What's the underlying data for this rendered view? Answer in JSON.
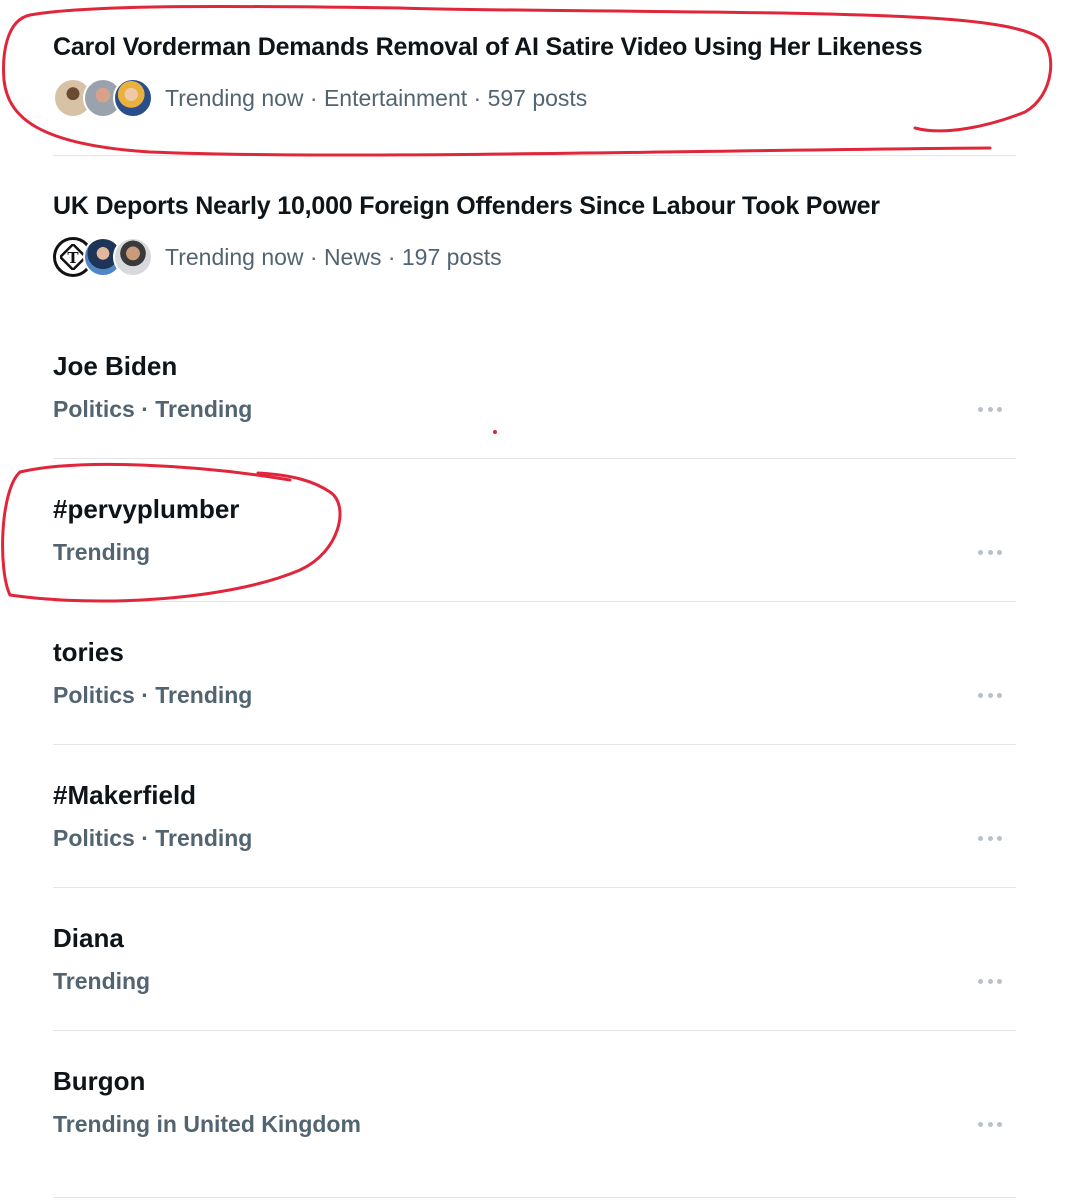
{
  "stories": [
    {
      "title": "Carol Vorderman Demands Removal of AI Satire Video Using Her Likeness",
      "meta": "Trending now · Entertainment · 597 posts",
      "avatars": [
        "avatar-person",
        "avatar-person",
        "avatar-person"
      ]
    },
    {
      "title": "UK Deports Nearly 10,000 Foreign Offenders Since Labour Took Power",
      "meta": "Trending now · News · 197 posts",
      "avatars": [
        "telegraph-logo",
        "avatar-person",
        "avatar-person"
      ]
    }
  ],
  "trends": [
    {
      "name": "Joe Biden",
      "context": "Politics · Trending"
    },
    {
      "name": "#pervyplumber",
      "context": "Trending"
    },
    {
      "name": "tories",
      "context": "Politics · Trending"
    },
    {
      "name": "#Makerfield",
      "context": "Politics · Trending"
    },
    {
      "name": "Diana",
      "context": "Trending"
    },
    {
      "name": "Burgon",
      "context": "Trending in United Kingdom"
    }
  ],
  "icons": {
    "more": "more-horizontal-icon"
  },
  "colors": {
    "annotation": "#e0263a",
    "secondary_text": "#536471",
    "primary_text": "#0f1419",
    "divider": "#e3e6e8"
  }
}
